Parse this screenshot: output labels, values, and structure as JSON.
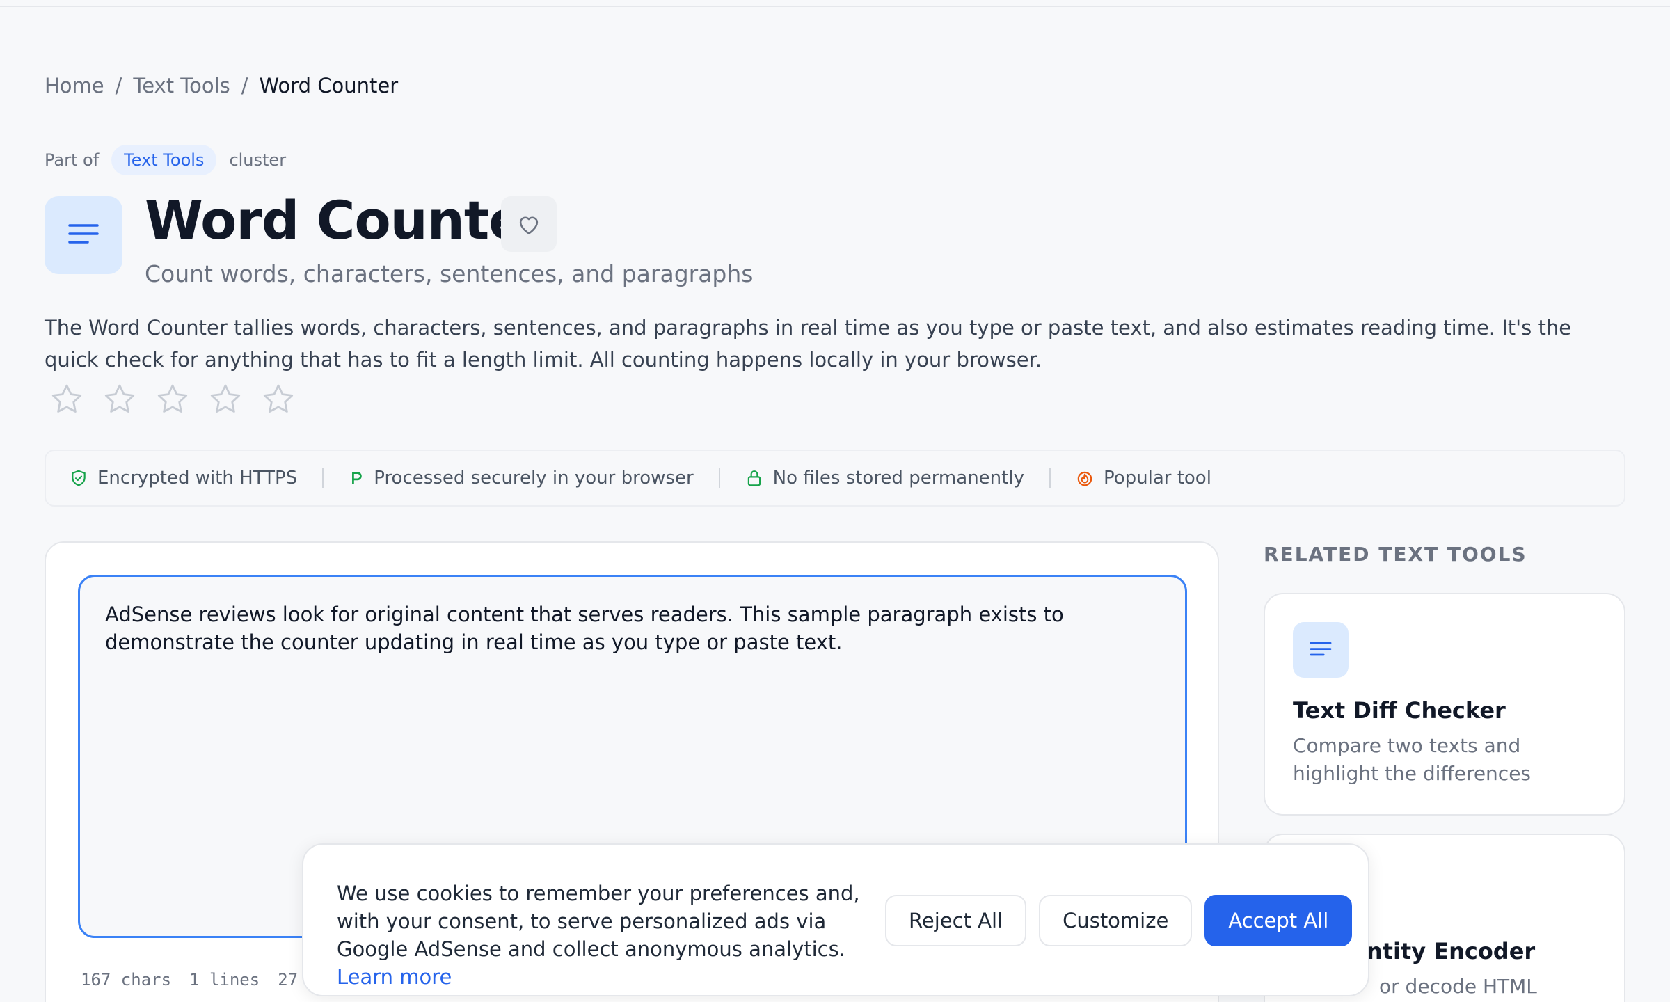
{
  "breadcrumb": {
    "home": "Home",
    "sep": "/",
    "section": "Text Tools",
    "current": "Word Counter"
  },
  "cluster": {
    "prefix": "Part of",
    "chip": "Text Tools",
    "suffix": "cluster"
  },
  "tool": {
    "icon": "lines-icon",
    "title": "Word Counter",
    "subtitle": "Count words, characters, sentences, and paragraphs",
    "description": "The Word Counter tallies words, characters, sentences, and paragraphs in real time as you type or paste text, and also estimates reading time. It's the quick check for anything that has to fit a length limit. All counting happens locally in your browser.",
    "rating": 0,
    "rating_max": 5
  },
  "trust": [
    {
      "icon": "shield-check-icon",
      "label": "Encrypted with HTTPS",
      "color": "#16a34a"
    },
    {
      "icon": "browser-icon",
      "label": "Processed securely in your browser",
      "color": "#16a34a"
    },
    {
      "icon": "lock-icon",
      "label": "No files stored permanently",
      "color": "#16a34a"
    },
    {
      "icon": "flame-icon",
      "label": "Popular tool",
      "color": "#ea580c"
    }
  ],
  "editor": {
    "text": "AdSense reviews look for original content that serves readers. This sample paragraph exists to demonstrate the counter updating in real time as you type or paste text.",
    "stats": {
      "chars": "167 chars",
      "lines": "1 lines",
      "words": "27"
    }
  },
  "related": {
    "heading": "RELATED TEXT TOOLS",
    "cards": [
      {
        "icon": "lines-icon",
        "name": "Text Diff Checker",
        "desc": "Compare two texts and highlight the differences"
      },
      {
        "icon": "code-icon",
        "name": "Entity Encoder",
        "desc": "or decode HTML"
      }
    ]
  },
  "cookie": {
    "message": "We use cookies to remember your preferences and, with your consent, to serve personalized ads via Google AdSense and collect anonymous analytics.",
    "learn_more": "Learn more",
    "reject": "Reject All",
    "customize": "Customize",
    "accept": "Accept All"
  },
  "colors": {
    "accent": "#2563eb",
    "icon_bg": "#dbeafe",
    "page_bg": "#f7f8fa"
  }
}
